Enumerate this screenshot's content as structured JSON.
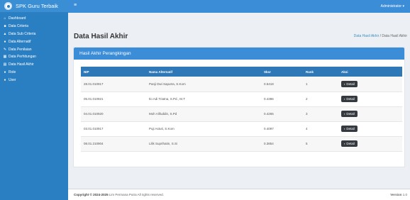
{
  "app": {
    "brand": "SPK Guru Terbaik"
  },
  "sidebar": {
    "items": [
      {
        "label": "Dashboard",
        "icon": "home-icon"
      },
      {
        "label": "Data Criteria",
        "icon": "cube-icon"
      },
      {
        "label": "Data Sub Criteria",
        "icon": "cubes-icon"
      },
      {
        "label": "Data Alternatif",
        "icon": "users-icon"
      },
      {
        "label": "Data Penilaian",
        "icon": "edit-icon"
      },
      {
        "label": "Data Perhitungan",
        "icon": "calculator-icon"
      },
      {
        "label": "Data Hasil Akhir",
        "icon": "chart-icon"
      },
      {
        "label": "Role",
        "icon": "users-icon"
      },
      {
        "label": "User",
        "icon": "users-icon"
      }
    ]
  },
  "topbar": {
    "user": "Administrator ▾",
    "menu_icon": "hamburger-icon"
  },
  "page": {
    "title": "Data Hasil Akhir",
    "breadcrumb_link": "Data Hasil Akhir",
    "breadcrumb_sep": "/",
    "breadcrumb_current": "Data Hasil Akhir"
  },
  "card": {
    "title": "Hasil Akhir Perangkingan"
  },
  "table": {
    "headers": [
      "NIP",
      "Nama Alternatif",
      "Skor",
      "Rank",
      "Aksi"
    ],
    "rows": [
      {
        "nip": "28.01.010917",
        "nama": "Panji Dwi Saputra, S.Kom",
        "skor": "0.5418",
        "rank": "1",
        "aksi": "Detail"
      },
      {
        "nip": "05.01.010921",
        "nama": "Ilo Adi Triatna, S.Pd., M.T",
        "skor": "0.4386",
        "rank": "2",
        "aksi": "Detail"
      },
      {
        "nip": "04.01.010920",
        "nama": "Moh Alifuddin, S.Pd",
        "skor": "0.4265",
        "rank": "3",
        "aksi": "Detail"
      },
      {
        "nip": "03.01.010917",
        "nama": "Puji Astuti, S.Kom",
        "skor": "0.4097",
        "rank": "4",
        "aksi": "Detail"
      },
      {
        "nip": "08.01.210904",
        "nama": "Lilik Suprihatin, S.Si",
        "skor": "0.3854",
        "rank": "5",
        "aksi": "Detail"
      }
    ]
  },
  "footer": {
    "copyright": "Copyright © 2024-2025",
    "owner": "Lim Permana Putra All rights reserved.",
    "version_label": "Version",
    "version": "1.0"
  }
}
